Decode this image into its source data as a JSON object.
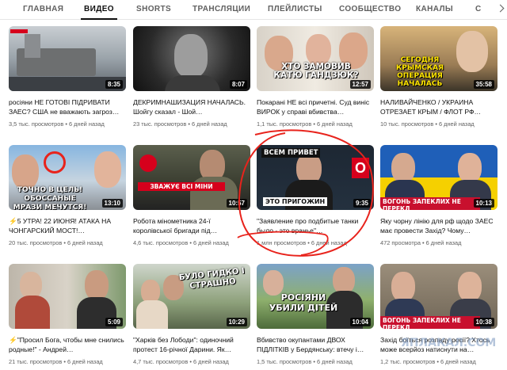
{
  "tabs": [
    {
      "label": "ГЛАВНАЯ"
    },
    {
      "label": "ВИДЕО",
      "active": true
    },
    {
      "label": "SHORTS"
    },
    {
      "label": "ТРАНСЛЯЦИИ"
    },
    {
      "label": "ПЛЕЙЛИСТЫ"
    },
    {
      "label": "СООБЩЕСТВО"
    },
    {
      "label": "КАНАЛЫ"
    },
    {
      "label": "С"
    }
  ],
  "videos": [
    {
      "title": "росіяни НЕ ГОТОВІ ПІДРИВАТИ ЗАЕС? США не вважають загроз…",
      "views": "3,5 тыс. просмотров",
      "age": "6 дней назад",
      "duration": "8:35",
      "caption": ""
    },
    {
      "title": "ДЕКРИМНАШИЗАЦИЯ НАЧАЛАСЬ. Шойгу сказал - Шой…",
      "views": "23 тыс. просмотров",
      "age": "6 дней назад",
      "duration": "8:07",
      "caption": ""
    },
    {
      "title": "Покарані НЕ всі причетні. Суд виніс ВИРОК у справі вбивства…",
      "views": "1,1 тыс. просмотров",
      "age": "6 дней назад",
      "duration": "12:57",
      "caption": "ХТО ЗАМОВИВ КАТЮ ГАНДЗЮК?"
    },
    {
      "title": "НАЛИВАЙЧЕНКО / УКРАИНА ОТРЕЗАЕТ КРЫМ / ФЛОТ РФ…",
      "views": "10 тыс. просмотров",
      "age": "6 дней назад",
      "duration": "35:58",
      "caption": "СЕГОДНЯ КРЫМСКАЯ ОПЕРАЦИЯ НАЧАЛАСЬ"
    },
    {
      "title": "⚡5 УТРА! 22 ИЮНЯ! АТАКА НА ЧОНГАРСКИЙ МОСТ!…",
      "views": "20 тыс. просмотров",
      "age": "6 дней назад",
      "duration": "13:10",
      "caption": "ТОЧНО В ЦЕЛЬ! ОБОССАНЫЕ МРАЗИ МЕЧУТСЯ!"
    },
    {
      "title": "Робота мінометника 24-ї королівської бригади під…",
      "views": "4,6 тыс. просмотров",
      "age": "6 дней назад",
      "duration": "10:57",
      "caption": "ЗВАЖУЄ ВСІ МІНИ"
    },
    {
      "title": "\"Заявление про подбитые танки было - это вранье\"…",
      "views": "1 млн просмотров",
      "age": "6 дней назад",
      "duration": "9:35",
      "caption": "ЭТО ПРИГОЖИН"
    },
    {
      "title": "Яку чорну лінію для рф щодо ЗАЕС має провести Захід? Чому…",
      "views": "472 просмотра",
      "age": "6 дней назад",
      "duration": "10:13",
      "caption": "ВОГОНЬ ЗАПЕКЛИХ НЕ ПЕРЕКЛ"
    },
    {
      "title": "⚡\"Просил Бога, чтобы мне снились родные!\" - Андрей…",
      "views": "21 тыс. просмотров",
      "age": "6 дней назад",
      "duration": "5:09",
      "caption": ""
    },
    {
      "title": "\"Харків без Лободи\": одиночний протест 16-річної Дарини. Як…",
      "views": "4,7 тыс. просмотров",
      "age": "6 дней назад",
      "duration": "10:29",
      "caption": "БУЛО ГИДКО І СТРАШНО"
    },
    {
      "title": "Вбивство окупантами ДВОХ ПІДЛІТКІВ у Бердянську: втечу і…",
      "views": "1,5 тыс. просмотров",
      "age": "6 дней назад",
      "duration": "10:04",
      "caption": "РОСІЯНИ УБИЛИ ДІТЕЙ"
    },
    {
      "title": "Захід боїться розпаду росії? Хтось може всерйоз натиснути на…",
      "views": "1,2 тыс. просмотров",
      "age": "6 дней назад",
      "duration": "10:38",
      "caption": "ВОГОНЬ ЗАПЕКЛИХ НЕ ПЕРЕКЛ"
    }
  ],
  "overlay_caption_top": "ВСЕМ ПРИВЕТ",
  "watermark": "ЯПЛАКАЛ.COM"
}
